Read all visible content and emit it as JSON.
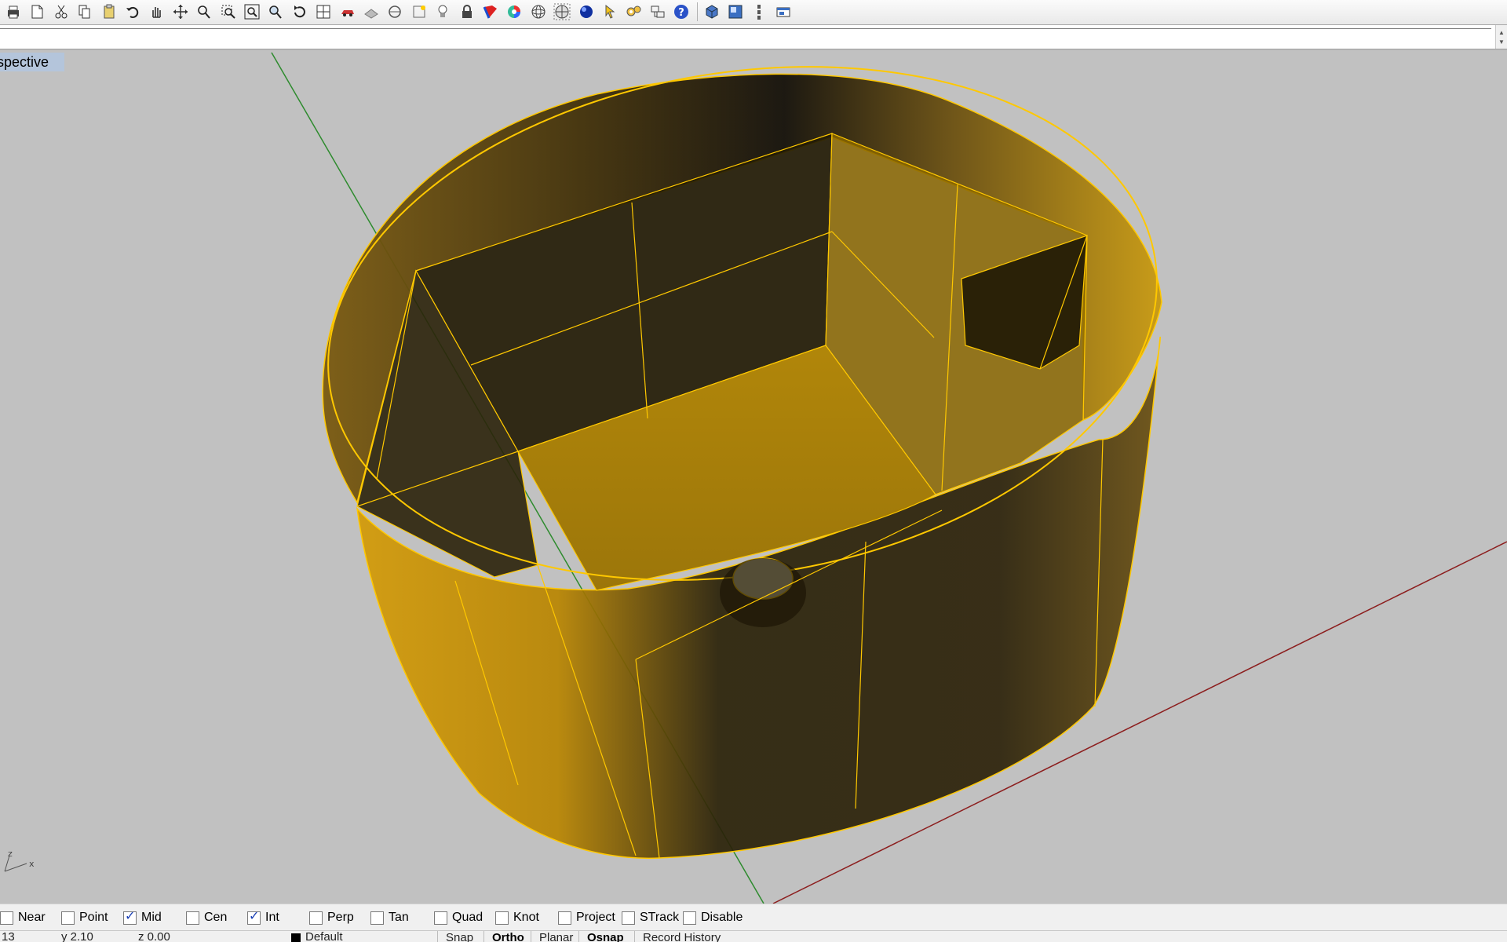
{
  "toolbar": {
    "icons": [
      "print-icon",
      "new-page-icon",
      "cut-icon",
      "copy-icon",
      "paste-icon",
      "undo-icon",
      "pan-hand-icon",
      "move-axes-icon",
      "zoom-icon",
      "zoom-window-icon",
      "zoom-extents-icon",
      "zoom-selected-icon",
      "rotate-view-icon",
      "four-viewports-icon",
      "car-icon",
      "shade-icon",
      "circle-select-icon",
      "snap-grid-icon",
      "light-bulb-icon",
      "lock-icon",
      "material-icon",
      "color-wheel-icon",
      "sphere-wire-icon",
      "sphere-grid-icon",
      "render-sphere-icon",
      "pointer-arrow-icon",
      "gears-icon",
      "options-icon",
      "help-icon",
      "view-cube-icon",
      "viewport-layout-icon",
      "vertical-dots-icon",
      "window-icon"
    ]
  },
  "viewport": {
    "title": "rspective"
  },
  "axes_widget": {
    "z_label": "z",
    "x_label": "x"
  },
  "osnap": {
    "items": [
      {
        "label": "Near",
        "checked": false
      },
      {
        "label": "Point",
        "checked": false
      },
      {
        "label": "Mid",
        "checked": true
      },
      {
        "label": "Cen",
        "checked": false
      },
      {
        "label": "Int",
        "checked": true
      },
      {
        "label": "Perp",
        "checked": false
      },
      {
        "label": "Tan",
        "checked": false
      },
      {
        "label": "Quad",
        "checked": false
      },
      {
        "label": "Knot",
        "checked": false
      },
      {
        "label": "Project",
        "checked": false
      },
      {
        "label": "STrack",
        "checked": false
      },
      {
        "label": "Disable",
        "checked": false
      }
    ]
  },
  "status": {
    "x": "13",
    "y": "y 2.10",
    "z": "z 0.00",
    "layer": "Default",
    "panes": [
      "Snap",
      "Ortho",
      "Planar",
      "Osnap",
      "Record History"
    ],
    "bold_panes": [
      "Ortho",
      "Osnap"
    ]
  },
  "colors": {
    "object": "#e0a800",
    "edge": "#ffc800",
    "x_axis": "#8c1e1e",
    "y_axis": "#2e8b2e",
    "viewport_bg": "#c1c1c1"
  }
}
